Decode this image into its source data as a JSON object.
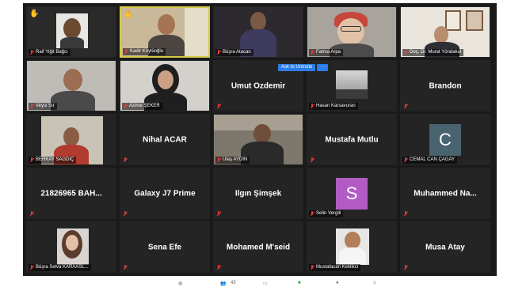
{
  "colors": {
    "background": "#1a1a1a",
    "tile": "#242424",
    "active_border": "#d6c94a",
    "muted_mic": "#e23b3b",
    "button": "#2b7de9",
    "raised_hand": "#f2c230"
  },
  "popover": {
    "unmute_label": "Ask to Unmute",
    "more_label": "···"
  },
  "participants": [
    {
      "name": "Raif Yiğit Bağcı",
      "has_video": true,
      "hand": true
    },
    {
      "name": "Kadir Köylüoğlu",
      "has_video": true,
      "hand": true,
      "active": true
    },
    {
      "name": "Büşra Atacan",
      "has_video": true
    },
    {
      "name": "Fatma Arpa",
      "has_video": true
    },
    {
      "name": "Doç. Dr. Murat Yöndakul",
      "has_video": true
    },
    {
      "name": "Veysi Sır",
      "has_video": true
    },
    {
      "name": "Azime ŞEKER",
      "has_video": true
    },
    {
      "name": "Umut Özdemir",
      "has_video": false
    },
    {
      "name": "Hasan Karsavuran",
      "has_video": true
    },
    {
      "name": "Brandon",
      "has_video": false
    },
    {
      "name": "BERKAY SAĞDIÇ",
      "has_video": true
    },
    {
      "name": "Nihal ACAR",
      "has_video": false
    },
    {
      "name": "Ulaş AYDIN",
      "has_video": true
    },
    {
      "name": "Mustafa Mutlu",
      "has_video": false
    },
    {
      "name": "CEMAL CAN ÇAĞAY",
      "has_video": false,
      "avatar": "C",
      "avatar_color": "#4a6370"
    },
    {
      "name": "21826965 BAH...",
      "has_video": false
    },
    {
      "name": "Galaxy J7 Prime",
      "has_video": false
    },
    {
      "name": "Ilgın Şimşek",
      "has_video": false
    },
    {
      "name": "Selin Vergili",
      "has_video": false,
      "avatar": "S",
      "avatar_color": "#b25bc4"
    },
    {
      "name": "Muhammed Na...",
      "has_video": false
    },
    {
      "name": "Büşra Selva KARAASL...",
      "has_video": true
    },
    {
      "name": "Sena Efe",
      "has_video": false
    },
    {
      "name": "Mohamed M'seid",
      "has_video": false
    },
    {
      "name": "Mustafacan Keklikci",
      "has_video": true
    },
    {
      "name": "Musa Atay",
      "has_video": false
    }
  ],
  "toolbar": {
    "participants_count": "45"
  }
}
